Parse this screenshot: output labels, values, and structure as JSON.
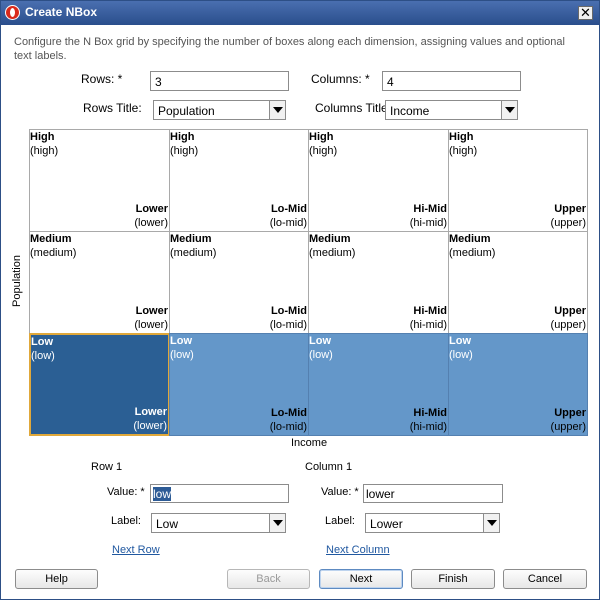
{
  "window": {
    "title": "Create NBox",
    "close_glyph": "✕"
  },
  "description": "Configure the N Box grid by specifying the number of boxes along each dimension, assigning values and optional text labels.",
  "rows": {
    "label": "Rows: *",
    "value": "3"
  },
  "columns": {
    "label": "Columns: *",
    "value": "4"
  },
  "rows_title": {
    "label": "Rows Title:",
    "value": "Population"
  },
  "columns_title": {
    "label": "Columns Title:",
    "value": "Income"
  },
  "grid": {
    "y_title": "Population",
    "x_title": "Income",
    "rows": [
      {
        "label": "High",
        "value": "(high)"
      },
      {
        "label": "Medium",
        "value": "(medium)"
      },
      {
        "label": "Low",
        "value": "(low)"
      }
    ],
    "columns": [
      {
        "label": "Lower",
        "value": "(lower)"
      },
      {
        "label": "Lo-Mid",
        "value": "(lo-mid)"
      },
      {
        "label": "Hi-Mid",
        "value": "(hi-mid)"
      },
      {
        "label": "Upper",
        "value": "(upper)"
      }
    ],
    "selected_row": 3,
    "selected_column": 1,
    "highlight_color": "#6497c9",
    "selected_color": "#2b5f94",
    "selection_border": "#e0a83a"
  },
  "row_section": {
    "title": "Row 1",
    "value_label": "Value: *",
    "value": "low",
    "label_label": "Label:",
    "label_value": "Low",
    "next_link": "Next Row"
  },
  "column_section": {
    "title": "Column 1",
    "value_label": "Value: *",
    "value": "lower",
    "label_label": "Label:",
    "label_value": "Lower",
    "next_link": "Next Column"
  },
  "buttons": {
    "help": "Help",
    "back": "Back",
    "next": "Next",
    "finish": "Finish",
    "cancel": "Cancel"
  },
  "icons": {
    "app": "oracle-logo-icon",
    "close": "close-icon",
    "dropdown": "chevron-down-icon"
  }
}
